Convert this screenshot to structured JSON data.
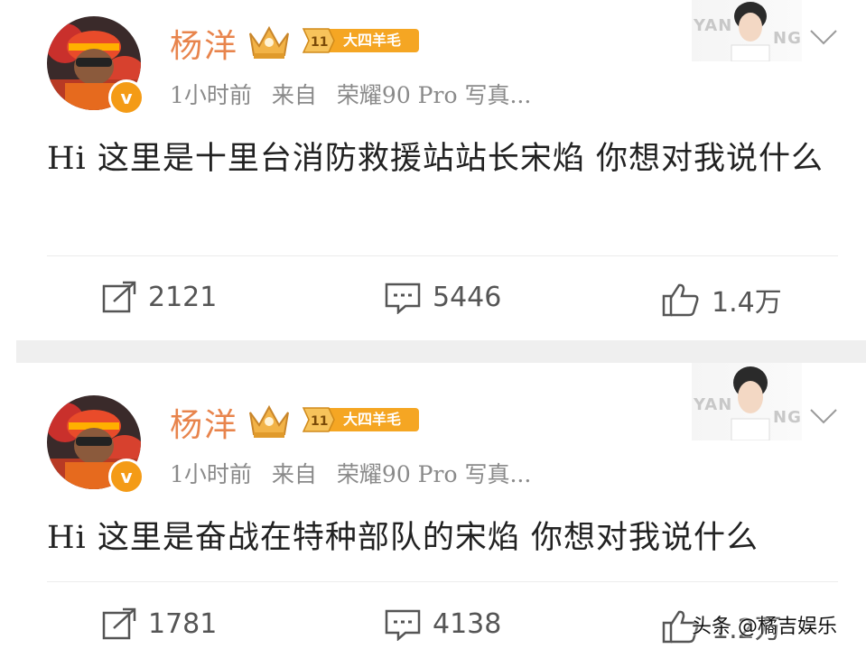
{
  "posts": [
    {
      "user": {
        "name": "杨洋",
        "badge_level": "11",
        "badge_text": "大四羊毛",
        "verified_glyph": "v"
      },
      "meta": {
        "time": "1小时前",
        "source_prefix": "来自",
        "device": "荣耀90 Pro 写真..."
      },
      "card_text_left": "YAN",
      "card_text_right": "NG",
      "content": "Hi 这里是十里台消防救援站站长宋焰 你想对我说什么",
      "actions": {
        "repost": "2121",
        "comment": "5446",
        "like": "1.4万"
      }
    },
    {
      "user": {
        "name": "杨洋",
        "badge_level": "11",
        "badge_text": "大四羊毛",
        "verified_glyph": "v"
      },
      "meta": {
        "time": "1小时前",
        "source_prefix": "来自",
        "device": "荣耀90 Pro 写真..."
      },
      "card_text_left": "YAN",
      "card_text_right": "NG",
      "content": "Hi 这里是奋战在特种部队的宋焰 你想对我说什么",
      "actions": {
        "repost": "1781",
        "comment": "4138",
        "like": "1.2万"
      }
    }
  ],
  "watermark": "头条 @橘吉娱乐",
  "colors": {
    "username": "#e8844c",
    "verified": "#f49b16",
    "badge": "#f5a623",
    "divider": "#efefef"
  },
  "icons": [
    "repost-icon",
    "comment-icon",
    "like-icon",
    "chevron-down-icon",
    "crown-icon",
    "verified-icon"
  ]
}
